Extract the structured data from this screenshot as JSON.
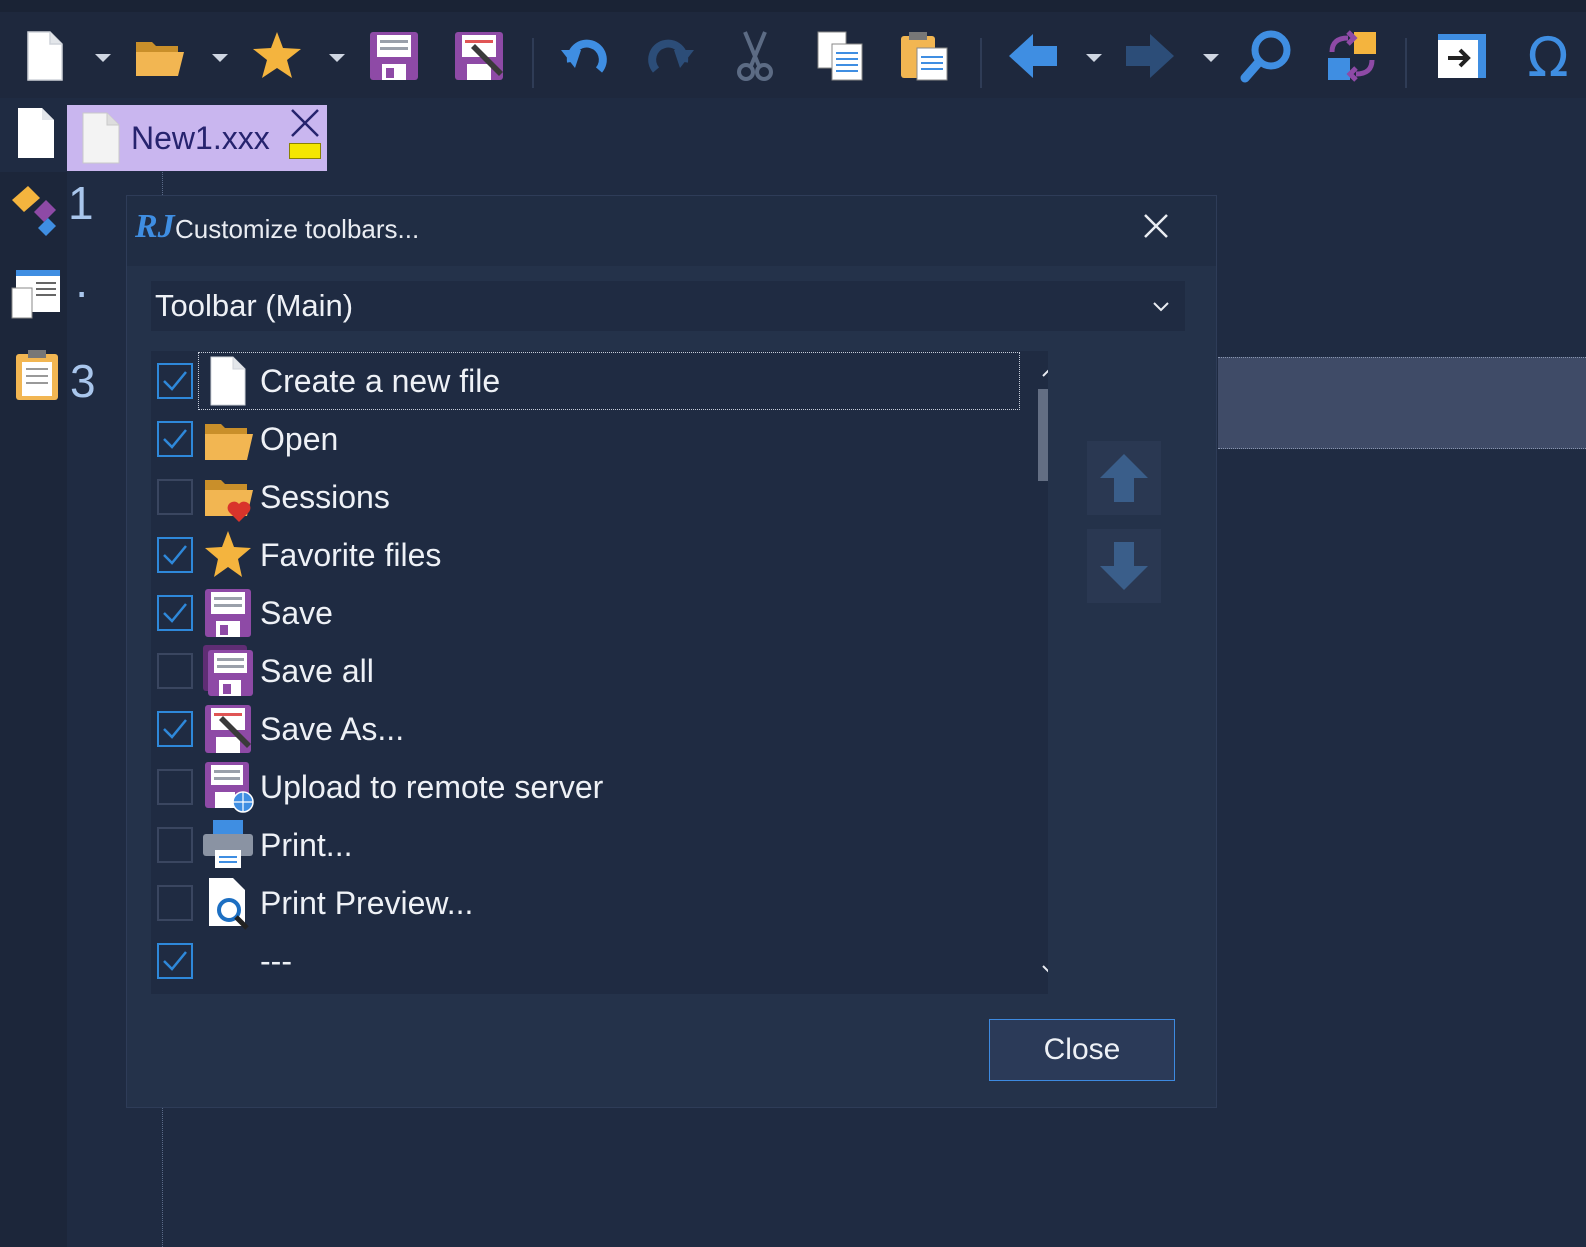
{
  "toolbar": {
    "buttons": [
      {
        "name": "new-file",
        "icon": "new-file-icon",
        "has_dropdown": true
      },
      {
        "name": "open",
        "icon": "folder-icon",
        "has_dropdown": true
      },
      {
        "name": "favorites",
        "icon": "star-icon",
        "has_dropdown": true
      },
      {
        "name": "save",
        "icon": "floppy-icon"
      },
      {
        "name": "save-as",
        "icon": "floppy-pen-icon"
      },
      {
        "name": "undo",
        "icon": "undo-icon"
      },
      {
        "name": "redo",
        "icon": "redo-icon",
        "disabled": true
      },
      {
        "name": "cut",
        "icon": "scissors-icon",
        "disabled": true
      },
      {
        "name": "copy",
        "icon": "copy-icon"
      },
      {
        "name": "paste",
        "icon": "paste-icon"
      },
      {
        "name": "back",
        "icon": "arrow-left-icon",
        "has_dropdown": true
      },
      {
        "name": "forward",
        "icon": "arrow-right-icon",
        "has_dropdown": true,
        "disabled": true
      },
      {
        "name": "find",
        "icon": "magnifier-icon"
      },
      {
        "name": "replace",
        "icon": "swap-icon"
      },
      {
        "name": "goto",
        "icon": "goto-icon"
      },
      {
        "name": "special-char",
        "icon": "omega-icon"
      }
    ]
  },
  "tab": {
    "label": "New1.xxx"
  },
  "gutter": {
    "numbers": [
      "1",
      "·",
      "3"
    ]
  },
  "dialog": {
    "logo": "RJ",
    "title": "Customize toolbars...",
    "toolbar_select": "Toolbar (Main)",
    "items": [
      {
        "label": "Create a new file",
        "checked": true,
        "icon": "new-file-icon"
      },
      {
        "label": "Open",
        "checked": true,
        "icon": "folder-icon"
      },
      {
        "label": "Sessions",
        "checked": false,
        "icon": "folder-heart-icon"
      },
      {
        "label": "Favorite files",
        "checked": true,
        "icon": "star-icon"
      },
      {
        "label": "Save",
        "checked": true,
        "icon": "floppy-icon"
      },
      {
        "label": "Save all",
        "checked": false,
        "icon": "floppy-stack-icon"
      },
      {
        "label": "Save As...",
        "checked": true,
        "icon": "floppy-pen-icon"
      },
      {
        "label": "Upload to remote server",
        "checked": false,
        "icon": "floppy-globe-icon"
      },
      {
        "label": "Print...",
        "checked": false,
        "icon": "printer-icon"
      },
      {
        "label": "Print Preview...",
        "checked": false,
        "icon": "print-preview-icon"
      },
      {
        "label": "---",
        "checked": true,
        "icon": ""
      }
    ],
    "close_label": "Close"
  },
  "colors": {
    "accent": "#2e88da",
    "tab_bg": "#c9b6ef",
    "background": "#1f2b42"
  }
}
